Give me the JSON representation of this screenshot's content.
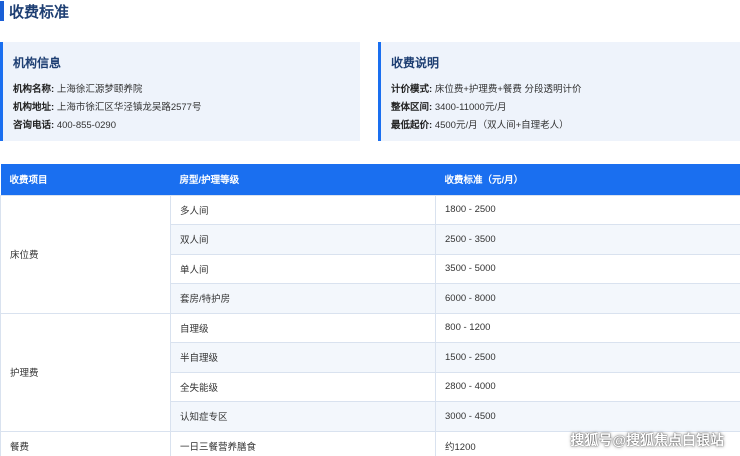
{
  "page_title": "收费标准",
  "institution": {
    "title": "机构信息",
    "name_label": "机构名称:",
    "name": "上海徐汇源梦颐养院",
    "address_label": "机构地址:",
    "address": "上海市徐汇区华泾镇龙吴路2577号",
    "phone_label": "咨询电话:",
    "phone": "400-855-0290"
  },
  "fee_notes": {
    "title": "收费说明",
    "mode_label": "计价模式:",
    "mode": "床位费+护理费+餐费 分段透明计价",
    "range_label": "整体区间:",
    "range": "3400-11000元/月",
    "min_label": "最低起价:",
    "min": "4500元/月（双人间+自理老人）"
  },
  "table": {
    "headers": [
      "收费项目",
      "房型/护理等级",
      "收费标准（元/月）"
    ],
    "groups": [
      {
        "category": "床位费",
        "rows": [
          {
            "type": "多人间",
            "price": "1800 - 2500"
          },
          {
            "type": "双人间",
            "price": "2500 - 3500"
          },
          {
            "type": "单人间",
            "price": "3500 - 5000"
          },
          {
            "type": "套房/特护房",
            "price": "6000 - 8000"
          }
        ]
      },
      {
        "category": "护理费",
        "rows": [
          {
            "type": "自理级",
            "price": "800 - 1200"
          },
          {
            "type": "半自理级",
            "price": "1500 - 2500"
          },
          {
            "type": "全失能级",
            "price": "2800 - 4000"
          },
          {
            "type": "认知症专区",
            "price": "3000 - 4500"
          }
        ]
      },
      {
        "category": "餐费",
        "rows": [
          {
            "type": "一日三餐营养膳食",
            "price": "约1200"
          }
        ]
      }
    ]
  },
  "watermark": "搜狐号@搜狐焦点白银站"
}
